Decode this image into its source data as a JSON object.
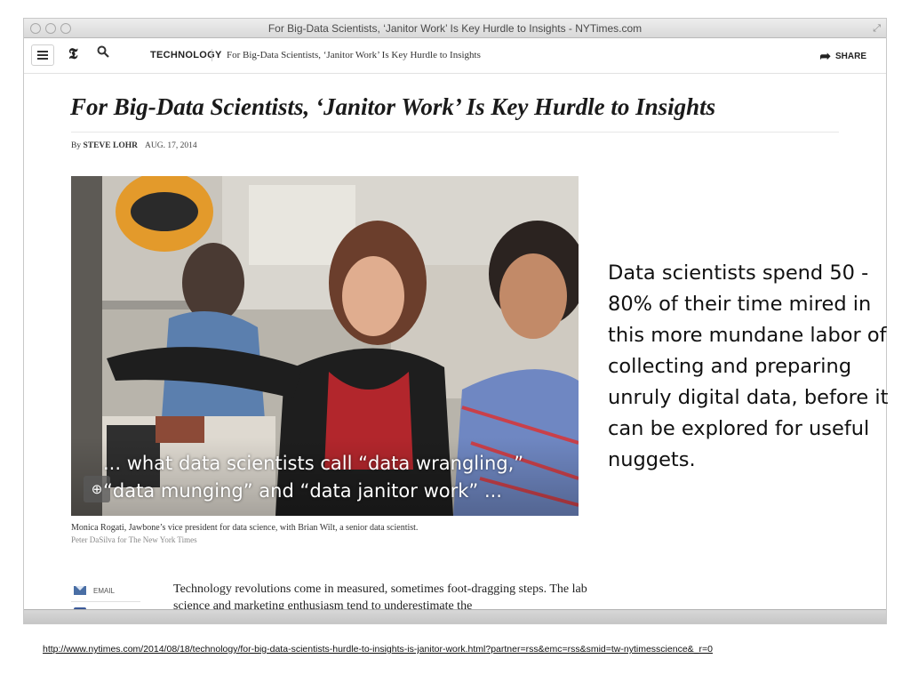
{
  "window": {
    "title": "For Big-Data Scientists, ‘Janitor Work’ Is Key Hurdle to Insights - NYTimes.com"
  },
  "navbar": {
    "logo": "𝕿",
    "section": "TECHNOLOGY",
    "headline": "For Big-Data Scientists, ‘Janitor Work’ Is Key Hurdle to Insights",
    "share_label": "SHARE"
  },
  "article": {
    "headline": "For Big-Data Scientists, ‘Janitor Work’ Is Key Hurdle to Insights",
    "byline_prefix": "By ",
    "author": "STEVE LOHR",
    "date": "AUG. 17, 2014",
    "photo_quote_line1": "... what data scientists call “data wrangling,”",
    "photo_quote_line2": "“data munging” and “data janitor work” ...",
    "caption": "Monica Rogati, Jawbone’s vice president for data science, with Brian Wilt, a senior data scientist.",
    "credit": "Peter DaSilva for The New York Times",
    "email_label": "EMAIL",
    "body": "Technology revolutions come in measured, sometimes foot-dragging steps. The lab science and marketing enthusiasm tend to underestimate the"
  },
  "slide": {
    "side_text": "Data scientists spend 50 - 80% of their time mired in this more mundane labor of collecting and preparing unruly digital data, before it can be explored for useful nuggets.",
    "source_url": "http://www.nytimes.com/2014/08/18/technology/for-big-data-scientists-hurdle-to-insights-is-janitor-work.html?partner=rss&emc=rss&smid=tw-nytimesscience&_r=0"
  }
}
